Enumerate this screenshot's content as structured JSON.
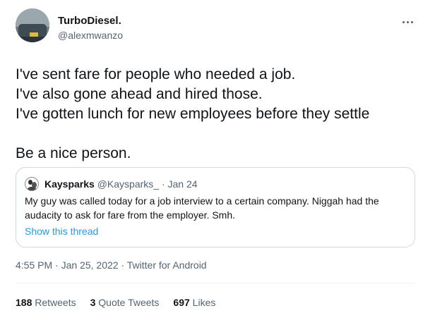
{
  "author": {
    "name": "TurboDiesel.",
    "handle": "@alexmwanzo"
  },
  "tweet": {
    "lines": [
      "I've sent fare for people who needed a job.",
      "I've also gone ahead and hired those.",
      "I've gotten lunch for new employees before they settle"
    ],
    "closing": "Be a nice person."
  },
  "quoted": {
    "name": "Kaysparks",
    "meta": "@Kaysparks_ · Jan 24",
    "text_lines": [
      "My guy was called today for a job interview to a certain company. Niggah had the",
      "audacity to ask for fare from the employer. Smh."
    ],
    "link": "Show this thread"
  },
  "timestamp": {
    "time": "4:55 PM",
    "sep1": " · ",
    "date": "Jan 25, 2022",
    "sep2": " · ",
    "source": "Twitter for Android"
  },
  "stats": {
    "retweets_count": "188",
    "retweets_label": " Retweets",
    "quotes_count": "3",
    "quotes_label": " Quote Tweets",
    "likes_count": "697",
    "likes_label": " Likes"
  }
}
